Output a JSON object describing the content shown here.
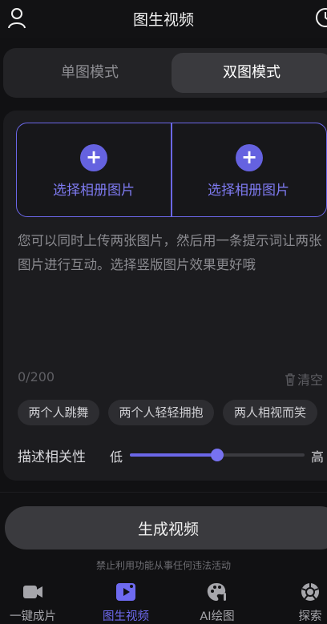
{
  "header": {
    "title": "图生视频"
  },
  "modes": {
    "single": "单图模式",
    "double": "双图模式",
    "selected": "双图模式"
  },
  "picker": {
    "left_label": "选择相册图片",
    "right_label": "选择相册图片",
    "plus": "+"
  },
  "prompt": {
    "placeholder": "您可以同时上传两张图片，然后用一条提示词让两张图片进行互动。选择竖版图片效果更好哦",
    "counter": "0/200",
    "clear_label": "清空"
  },
  "chips": [
    "两个人跳舞",
    "两个人轻轻拥抱",
    "两人相视而笑"
  ],
  "relevance": {
    "label": "描述相关性",
    "low": "低",
    "high": "高",
    "value": 0.5
  },
  "generate": {
    "label": "生成视频"
  },
  "notice": "禁止利用功能从事任何违法活动",
  "nav": {
    "items": [
      {
        "label": "一键成片",
        "icon": "video-camera-icon"
      },
      {
        "label": "图生视频",
        "icon": "image-play-icon"
      },
      {
        "label": "AI绘图",
        "icon": "palette-icon"
      },
      {
        "label": "探索",
        "icon": "aperture-icon"
      }
    ],
    "active": "图生视频"
  },
  "colors": {
    "accent": "#6b67e8",
    "background": "#111113",
    "panel": "#1c1c1f"
  }
}
